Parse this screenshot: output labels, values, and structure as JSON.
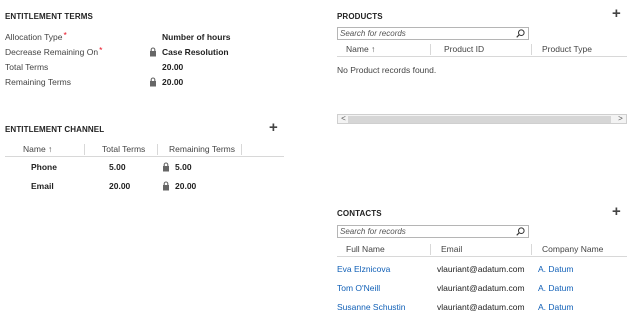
{
  "entitlement_terms": {
    "title": "ENTITLEMENT TERMS",
    "fields": [
      {
        "label": "Allocation Type",
        "required": "*",
        "value": "Number of hours",
        "locked": false
      },
      {
        "label": "Decrease Remaining On",
        "required": "*",
        "value": "Case Resolution",
        "locked": true
      },
      {
        "label": "Total Terms",
        "required": "",
        "value": "20.00",
        "locked": false
      },
      {
        "label": "Remaining Terms",
        "required": "",
        "value": "20.00",
        "locked": true
      }
    ]
  },
  "entitlement_channel": {
    "title": "ENTITLEMENT CHANNEL",
    "add_icon": "+",
    "columns": [
      "Name ↑",
      "Total Terms",
      "Remaining Terms"
    ],
    "rows": [
      {
        "name": "Phone",
        "total": "5.00",
        "remaining": "5.00"
      },
      {
        "name": "Email",
        "total": "20.00",
        "remaining": "20.00"
      }
    ]
  },
  "products": {
    "title": "PRODUCTS",
    "add_icon": "+",
    "search_placeholder": "Search for records",
    "columns": [
      "Name ↑",
      "Product ID",
      "Product Type"
    ],
    "empty_message": "No Product records found.",
    "scroll_left": "<",
    "scroll_right": ">"
  },
  "contacts": {
    "title": "CONTACTS",
    "add_icon": "+",
    "search_placeholder": "Search for records",
    "columns": [
      "Full Name",
      "Email",
      "Company Name"
    ],
    "rows": [
      {
        "name": "Eva Elznicova",
        "email": "vlauriant@adatum.com",
        "company": "A. Datum"
      },
      {
        "name": "Tom O'Neill",
        "email": "vlauriant@adatum.com",
        "company": "A. Datum"
      },
      {
        "name": "Susanne Schustin",
        "email": "vlauriant@adatum.com",
        "company": "A. Datum"
      }
    ]
  },
  "colors": {
    "link": "#1160b7",
    "required": "#e81123",
    "divider": "#d8d8d8"
  }
}
